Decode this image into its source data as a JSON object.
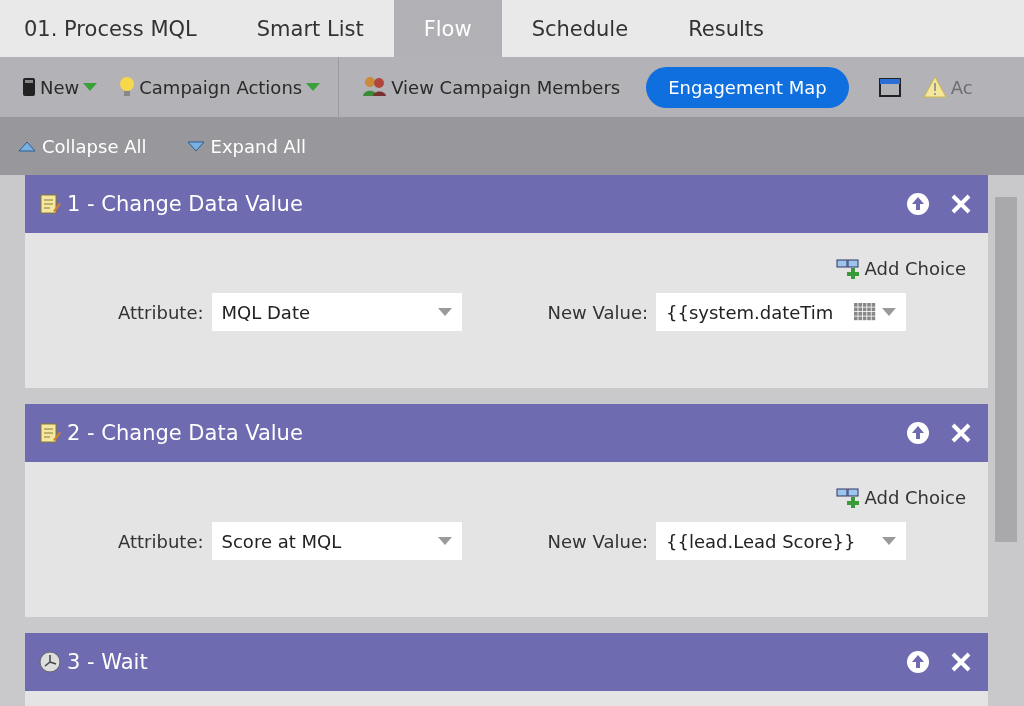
{
  "tabs": [
    {
      "label": "01. Process MQL",
      "selected": false
    },
    {
      "label": "Smart List",
      "selected": false
    },
    {
      "label": "Flow",
      "selected": true
    },
    {
      "label": "Schedule",
      "selected": false
    },
    {
      "label": "Results",
      "selected": false
    }
  ],
  "toolbar": [
    {
      "kind": "new",
      "label": "New"
    },
    {
      "kind": "actions",
      "label": "Campaign Actions"
    },
    {
      "kind": "divider"
    },
    {
      "kind": "members",
      "label": "View Campaign Members"
    },
    {
      "kind": "primary",
      "label": "Engagement Map"
    },
    {
      "kind": "window"
    },
    {
      "kind": "warning",
      "label": "Ac"
    }
  ],
  "subtoolbar": [
    {
      "kind": "collapse",
      "label": "Collapse All"
    },
    {
      "kind": "expand",
      "label": "Expand All"
    }
  ],
  "steps": [
    {
      "kind": "change_date",
      "title": "1 - Change Data Value",
      "add_choice": "Add Choice",
      "attribute_label": "Attribute:",
      "attribute": "MQL Date",
      "value_label": "New Value:",
      "value": "{{system.dateTim"
    },
    {
      "kind": "change_value",
      "title": "2 - Change Data Value",
      "add_choice": "Add Choice",
      "attribute_label": "Attribute:",
      "attribute": "Score at MQL",
      "value_label": "New Value:",
      "value": "{{lead.Lead Score}}"
    },
    {
      "kind": "wait",
      "title": "3 - Wait"
    }
  ]
}
